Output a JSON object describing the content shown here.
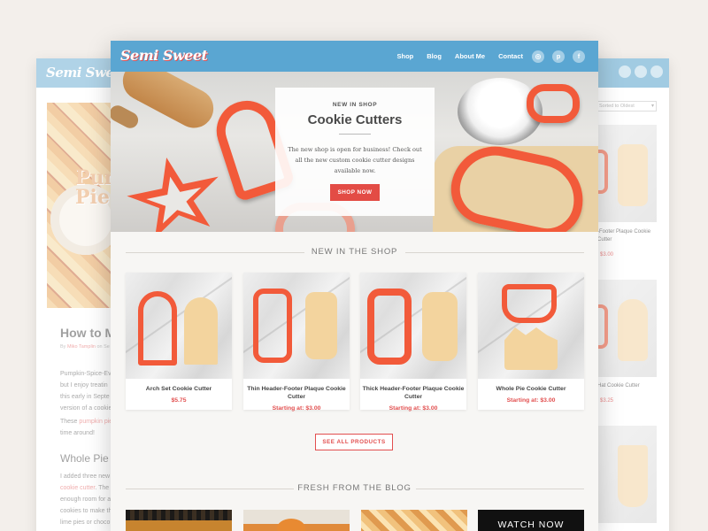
{
  "brand": {
    "name": "Semi Sweet"
  },
  "colors": {
    "nav_bg": "#5aa6d2",
    "accent_red": "#e24f4f",
    "cutter_orange": "#f25a3a",
    "dough": "#f3d49e",
    "page_bg": "#f3efeb"
  },
  "nav": {
    "items": [
      "Shop",
      "Blog",
      "About Me",
      "Contact"
    ],
    "social_icons": [
      "instagram-icon",
      "pinterest-icon",
      "facebook-icon"
    ]
  },
  "hero": {
    "eyebrow": "NEW IN SHOP",
    "title": "Cookie Cutters",
    "body": "The new shop is open for business! Check out all the new custom cookie cutter designs available now.",
    "button": "SHOP NOW"
  },
  "section_new": {
    "title": "NEW IN THE SHOP"
  },
  "products": [
    {
      "name": "Arch Set Cookie Cutter",
      "price": "$5.75"
    },
    {
      "name": "Thin Header-Footer Plaque Cookie Cutter",
      "price": "Starting at: $3.00"
    },
    {
      "name": "Thick Header-Footer Plaque Cookie Cutter",
      "price": "Starting at: $3.00"
    },
    {
      "name": "Whole Pie Cookie Cutter",
      "price": "Starting at: $3.00"
    }
  ],
  "see_all": "SEE ALL PRODUCTS",
  "section_blog": {
    "title": "FRESH FROM THE BLOG"
  },
  "blog_tiles": [
    {
      "overlay": ""
    },
    {
      "overlay": ""
    },
    {
      "overlay": ""
    },
    {
      "overlay": "WATCH NOW"
    }
  ],
  "left_window": {
    "hero_text": "Pump Pie",
    "post_title": "How to M",
    "meta_author": "Miko Tamplin",
    "meta_prefix": "By",
    "meta_suffix": "on Se",
    "para1": [
      "Pumpkin-Spice-Ev",
      "but I enjoy treatin",
      "this early in Septe",
      "version of a cookie"
    ],
    "para2_prefix": "These",
    "para2_link": "pumpkin pie",
    "para2_line2": "time around!",
    "h2": "Whole Pie Co",
    "para3_line1": "I added three new",
    "para3_link": "cookie cutter",
    "para3_line2_suffix": ". The",
    "para3": [
      "enough room for a",
      "cookies to make th",
      "lime pies or choco"
    ]
  },
  "right_window": {
    "sort_label": "Sorted to Oldest",
    "products": [
      {
        "name": "Thin Header-Footer Plaque Cookie Cutter",
        "price": "$3.00",
        "name_visible": "-Footer Plaque Cookie Cutter"
      },
      {
        "name": "Hat Cookie Cutter",
        "price": "$3.25",
        "name_visible": "Hat Cookie Cutter"
      }
    ]
  }
}
